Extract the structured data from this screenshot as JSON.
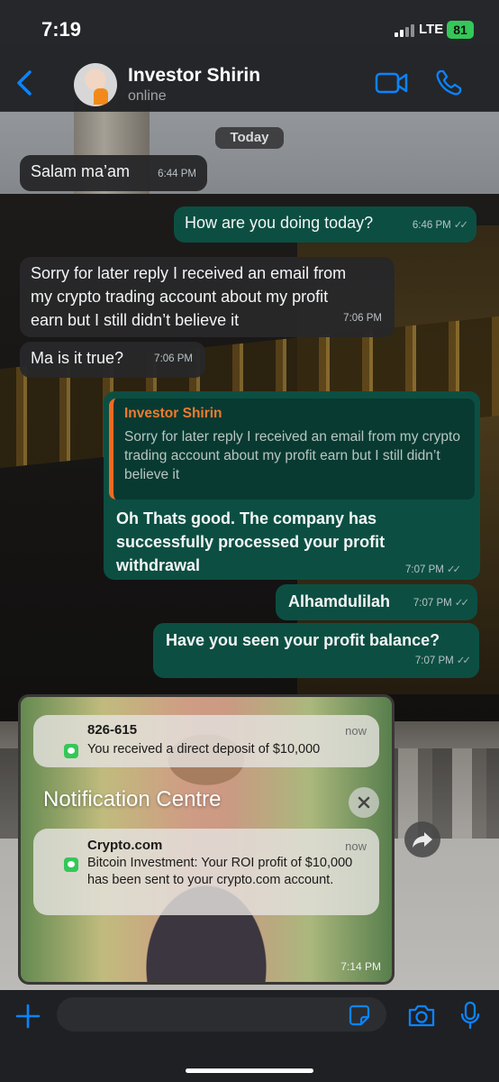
{
  "status_bar": {
    "time": "7:19",
    "network": "LTE",
    "battery": "81"
  },
  "header": {
    "contact_name": "Investor Shirin",
    "contact_status": "online"
  },
  "chat": {
    "date_label": "Today",
    "messages": [
      {
        "direction": "in",
        "text": "Salam ma’am",
        "time": "6:44 PM"
      },
      {
        "direction": "out",
        "text": "How are you doing today?",
        "time": "6:46 PM"
      },
      {
        "direction": "in",
        "text": "Sorry for later reply I received an email from my crypto trading account about my profit earn but I still didn’t believe it",
        "time": "7:06 PM"
      },
      {
        "direction": "in",
        "text": "Ma is it true?",
        "time": "7:06 PM"
      },
      {
        "direction": "out",
        "quote_author": "Investor Shirin",
        "quote_text": "Sorry for later reply I received an email from my crypto trading account about my profit earn but I still didn’t believe it",
        "text": "Oh Thats good. The company has successfully processed your profit withdrawal",
        "time": "7:07 PM"
      },
      {
        "direction": "out",
        "text": "Alhamdulilah",
        "time": "7:07 PM"
      },
      {
        "direction": "out",
        "text": "Have you seen your profit balance?",
        "time": "7:07 PM"
      }
    ],
    "image_message": {
      "time": "7:14 PM",
      "notifications": [
        {
          "sender": "826-615",
          "time": "now",
          "body": "You received a direct deposit of $10,000"
        },
        {
          "sender": "Crypto.com",
          "time": "now",
          "body": "Bitcoin Investment: Your ROI profit of $10,000 has been sent to your crypto.com account."
        }
      ],
      "notification_centre_title": "Notification Centre"
    }
  },
  "colors": {
    "accent_blue": "#0a84ff",
    "outgoing_bubble": "#0c4f42",
    "incoming_bubble": "#28282a",
    "quote_accent": "#f06a22",
    "battery_green": "#34c759"
  },
  "icons": [
    "back-chevron-icon",
    "video-call-icon",
    "phone-icon",
    "forward-icon",
    "plus-icon",
    "sticker-icon",
    "camera-icon",
    "microphone-icon",
    "close-icon",
    "messages-app-icon"
  ]
}
